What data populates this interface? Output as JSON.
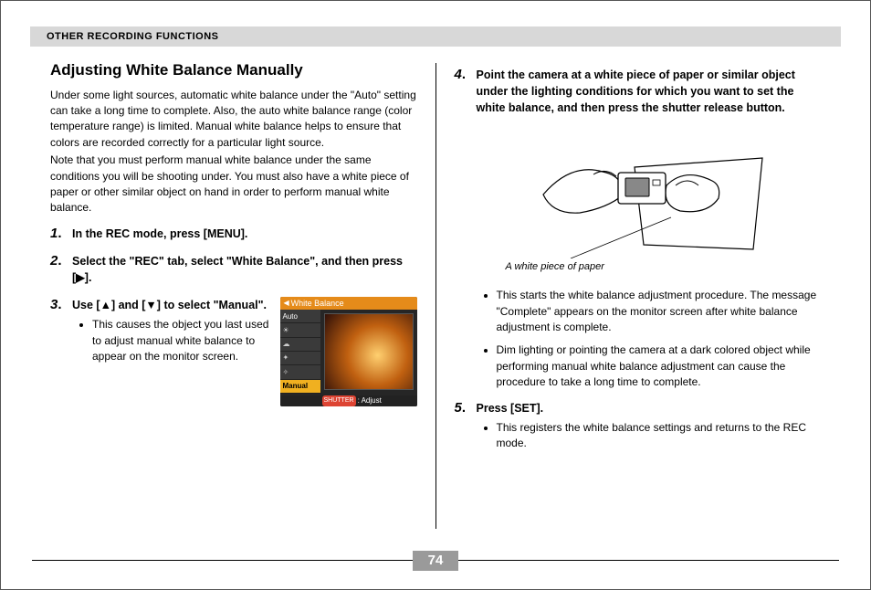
{
  "header": {
    "section_title": "OTHER RECORDING FUNCTIONS"
  },
  "page_number": "74",
  "left": {
    "heading": "Adjusting White Balance Manually",
    "intro_p1": "Under some light sources, automatic white balance under the \"Auto\" setting can take a long time to complete. Also, the auto white balance range (color temperature range) is limited. Manual white balance helps to ensure that colors are recorded correctly for a particular light source.",
    "intro_p2": "Note that you must perform manual white balance under the same conditions you will be shooting under. You must also have a white piece of paper or other similar object on hand in order to perform manual white balance.",
    "step1": {
      "num": "1",
      "title": "In the REC mode, press [MENU]."
    },
    "step2": {
      "num": "2",
      "title": "Select the \"REC\" tab, select \"White Balance\", and then press [▶]."
    },
    "step3": {
      "num": "3",
      "title": "Use [▲] and [▼] to select \"Manual\".",
      "bullet": "This causes the object you last used to adjust manual white balance to appear on the monitor screen."
    },
    "camera_menu": {
      "title": "White Balance",
      "items": [
        "Auto",
        "",
        "",
        "",
        "",
        "Manual"
      ],
      "selected": "Manual",
      "footer_btn": "SHUTTER",
      "footer_text": ": Adjust"
    }
  },
  "right": {
    "step4": {
      "num": "4",
      "title": "Point the camera at a white piece of paper or similar object under the lighting conditions for which you want to set the white balance, and then press the shutter release button.",
      "caption": "A white piece of paper",
      "bullet_a": "This starts the white balance adjustment procedure. The message \"Complete\" appears on the monitor screen after white balance adjustment is complete.",
      "bullet_b": "Dim lighting or pointing the camera at a dark colored object while performing manual white balance adjustment can cause the procedure to take a long time to complete."
    },
    "step5": {
      "num": "5",
      "title": "Press [SET].",
      "bullet": "This registers the white balance settings and returns to the REC mode."
    }
  }
}
